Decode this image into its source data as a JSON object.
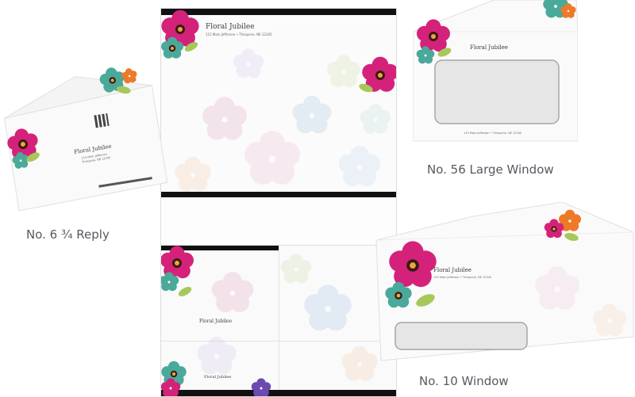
{
  "captions": {
    "reply": "No. 6 ¾ Reply",
    "large_window": "No. 56 Large Window",
    "window10": "No. 10 Window"
  },
  "brand": {
    "name": "Floral Jubilee",
    "address_line": "115 Main Jefferson • Thisquine, NE 12345",
    "reply_address_1": "115 Main Jefferson",
    "reply_address_2": "Thisquine, NE 12345"
  },
  "colors": {
    "magenta": "#d4227a",
    "teal": "#4aa99a",
    "orange": "#ee7a28",
    "lime": "#a6c85a",
    "purple": "#6a4ab0",
    "black": "#111111"
  }
}
